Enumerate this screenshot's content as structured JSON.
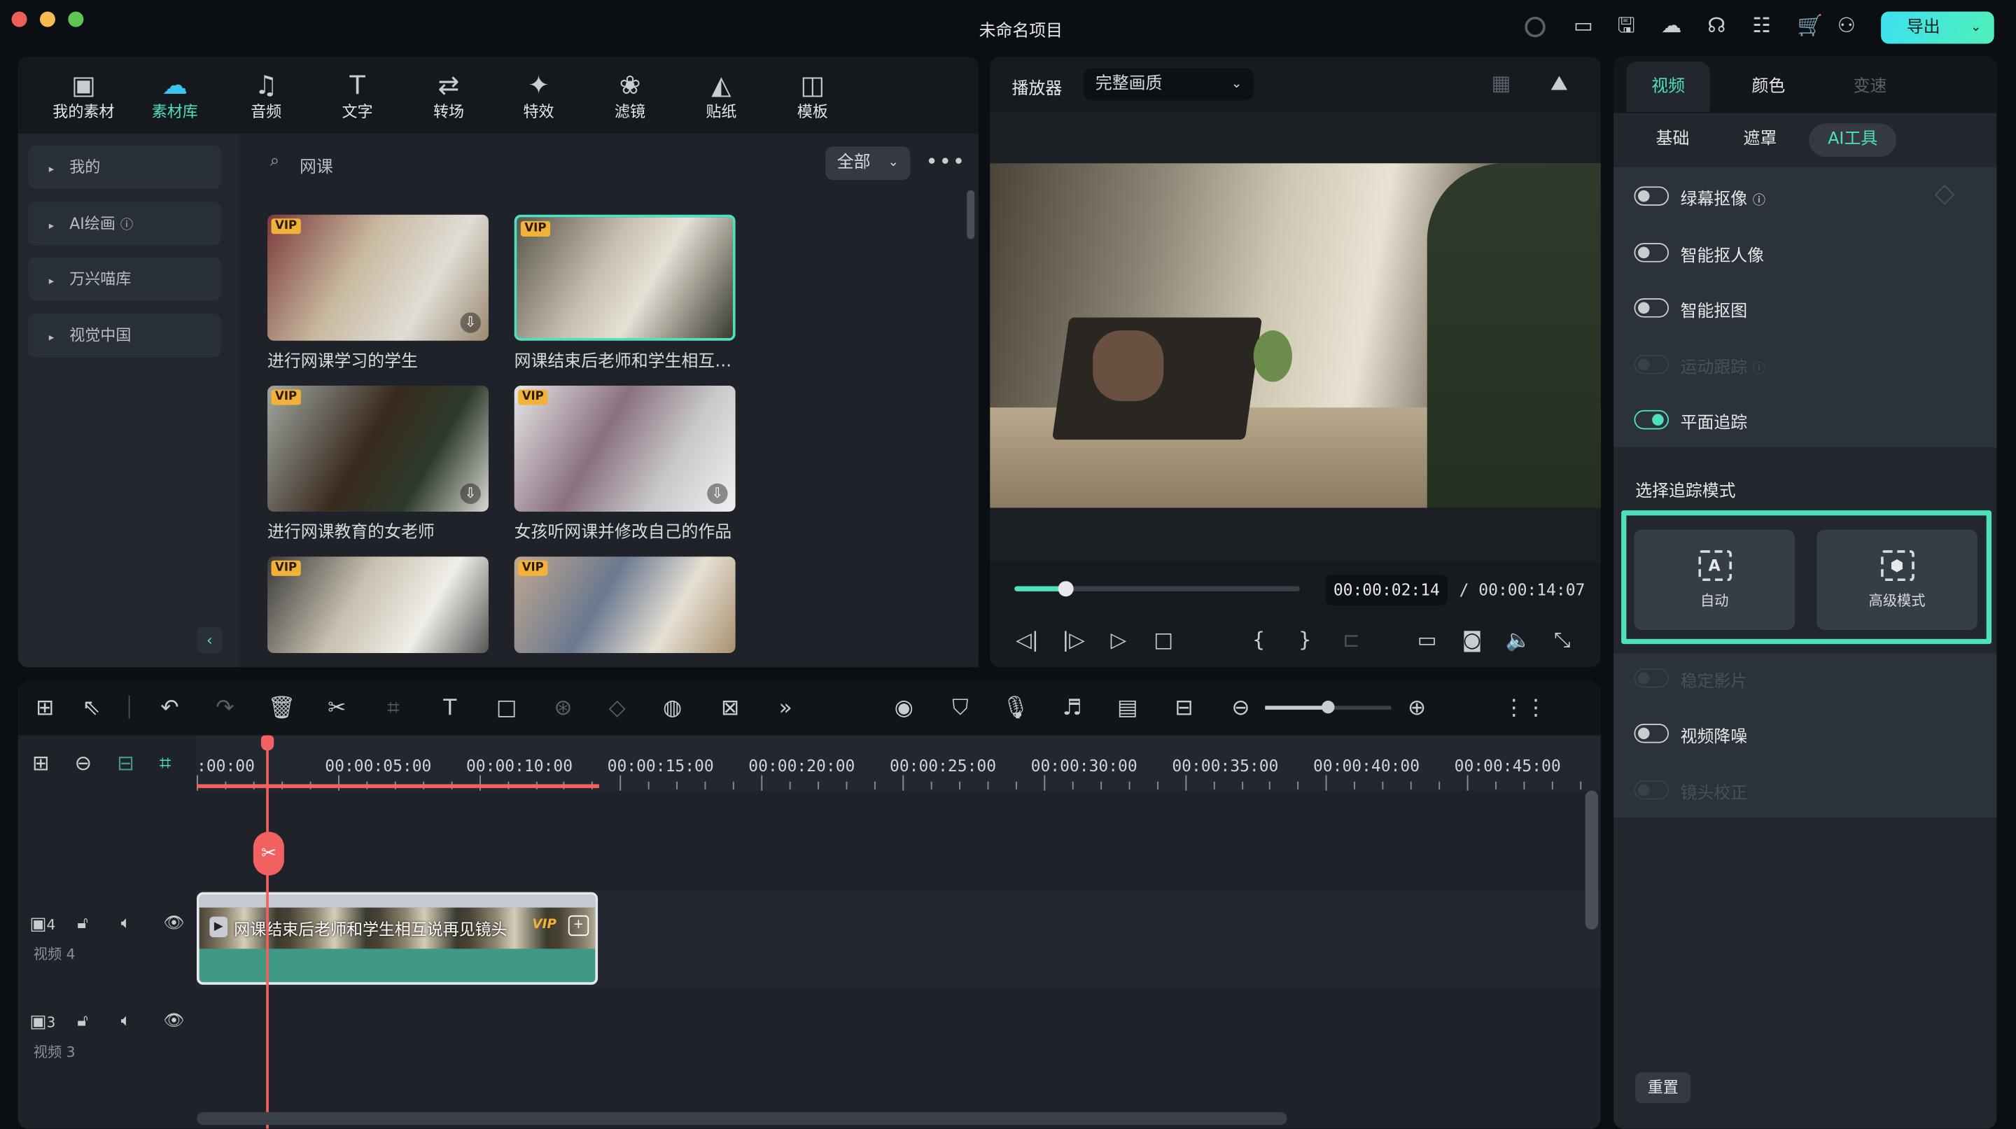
{
  "window": {
    "title": "未命名项目",
    "export_label": "导出"
  },
  "colors": {
    "accent": "#4fe0c0",
    "playhead": "#f26060",
    "vip": "#f2b23a",
    "clip_audio": "#3f9985"
  },
  "topbar_icons": [
    "record-icon",
    "layout-icon",
    "save-icon",
    "cloud-icon",
    "headset-icon",
    "apps-icon",
    "cart-icon",
    "user-icon"
  ],
  "media_tabs": [
    {
      "label": "我的素材",
      "glyph": "▣"
    },
    {
      "label": "素材库",
      "glyph": "☁"
    },
    {
      "label": "音频",
      "glyph": "♫"
    },
    {
      "label": "文字",
      "glyph": "T"
    },
    {
      "label": "转场",
      "glyph": "⇄"
    },
    {
      "label": "特效",
      "glyph": "✦"
    },
    {
      "label": "滤镜",
      "glyph": "❀"
    },
    {
      "label": "贴纸",
      "glyph": "◭"
    },
    {
      "label": "模板",
      "glyph": "◫"
    }
  ],
  "active_media_tab": 1,
  "sidebar": {
    "items": [
      {
        "label": "我的"
      },
      {
        "label": "AI绘画"
      },
      {
        "label": "万兴喵库"
      },
      {
        "label": "视觉中国"
      }
    ]
  },
  "search": {
    "value": "网课",
    "filter": "全部"
  },
  "assets": [
    {
      "caption": "进行网课学习的学生",
      "badge": "VIP"
    },
    {
      "caption": "网课结束后老师和学生相互说再见镜头",
      "badge": "VIP"
    },
    {
      "caption": "进行网课教育的女老师",
      "badge": "VIP"
    },
    {
      "caption": "女孩听网课并修改自己的作品",
      "badge": "VIP"
    },
    {
      "caption": "",
      "badge": "VIP"
    },
    {
      "caption": "",
      "badge": "VIP"
    }
  ],
  "player": {
    "label": "播放器",
    "quality": "完整画质",
    "current_time": "00:00:02:14",
    "total_time": "/ 00:00:14:07",
    "progress": 0.18
  },
  "inspector": {
    "tabs": [
      "视频",
      "颜色",
      "变速"
    ],
    "active_tab": 0,
    "subtabs": [
      "基础",
      "遮罩",
      "AI工具"
    ],
    "active_subtab": 2,
    "toggles": [
      {
        "label": "绿幕抠像",
        "on": false,
        "disabled": false
      },
      {
        "label": "智能抠人像",
        "on": false,
        "disabled": false
      },
      {
        "label": "智能抠图",
        "on": false,
        "disabled": false
      },
      {
        "label": "运动跟踪",
        "on": false,
        "disabled": true
      },
      {
        "label": "平面追踪",
        "on": true,
        "disabled": false
      }
    ],
    "tracking_title": "选择追踪模式",
    "modes": [
      {
        "label": "自动",
        "glyph": "A"
      },
      {
        "label": "高级模式",
        "glyph": "⬢"
      }
    ],
    "toggles2": [
      {
        "label": "稳定影片",
        "on": false,
        "disabled": true
      },
      {
        "label": "视频降噪",
        "on": false,
        "disabled": false
      },
      {
        "label": "镜头校正",
        "on": false,
        "disabled": true
      }
    ],
    "reset_label": "重置"
  },
  "timeline": {
    "ruler": [
      ":00:00",
      "00:00:05:00",
      "00:00:10:00",
      "00:00:15:00",
      "00:00:20:00",
      "00:00:25:00",
      "00:00:30:00",
      "00:00:35:00",
      "00:00:40:00",
      "00:00:45:00"
    ],
    "zoom_level": 0.5,
    "tracks": [
      {
        "num": "4",
        "name": "视频 4"
      },
      {
        "num": "3",
        "name": "视频 3"
      }
    ],
    "clip": {
      "title": "网课结束后老师和学生相互说再见镜头",
      "badge": "VIP"
    }
  }
}
